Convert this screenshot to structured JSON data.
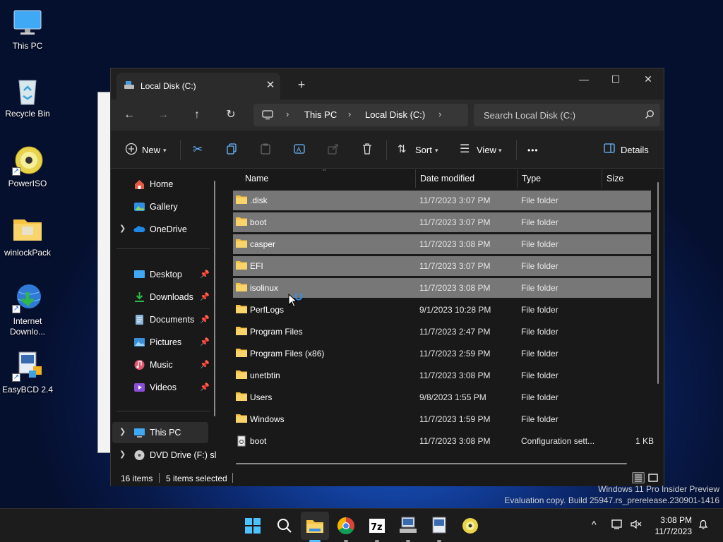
{
  "desktop": {
    "icons": [
      {
        "label": "This PC",
        "icon": "monitor-icon"
      },
      {
        "label": "Recycle Bin",
        "icon": "recycle-bin-icon"
      },
      {
        "label": "PowerISO",
        "icon": "disc-icon"
      },
      {
        "label": "winlockPack",
        "icon": "folder-icon"
      },
      {
        "label": "Internet Downlo...",
        "icon": "globe-download-icon"
      },
      {
        "label": "EasyBCD 2.4",
        "icon": "easybcd-icon"
      }
    ]
  },
  "window": {
    "tab_title": "Local Disk (C:)",
    "new_tab": "+",
    "controls": {
      "minimize": "—",
      "maximize": "☐",
      "close": "✕"
    }
  },
  "address": {
    "crumbs": [
      "This PC",
      "Local Disk (C:)"
    ],
    "search_placeholder": "Search Local Disk (C:)"
  },
  "commands": {
    "new": "New",
    "sort": "Sort",
    "view": "View",
    "more": "•••",
    "details": "Details"
  },
  "nav": {
    "home": "Home",
    "gallery": "Gallery",
    "onedrive": "OneDrive",
    "desktop": "Desktop",
    "downloads": "Downloads",
    "documents": "Documents",
    "pictures": "Pictures",
    "music": "Music",
    "videos": "Videos",
    "thispc": "This PC",
    "dvd": "DVD Drive (F:) sl"
  },
  "columns": {
    "name": "Name",
    "date": "Date modified",
    "type": "Type",
    "size": "Size"
  },
  "files": [
    {
      "name": ".disk",
      "date": "11/7/2023 3:07 PM",
      "type": "File folder",
      "size": "",
      "selected": true
    },
    {
      "name": "boot",
      "date": "11/7/2023 3:07 PM",
      "type": "File folder",
      "size": "",
      "selected": true
    },
    {
      "name": "casper",
      "date": "11/7/2023 3:08 PM",
      "type": "File folder",
      "size": "",
      "selected": true
    },
    {
      "name": "EFI",
      "date": "11/7/2023 3:07 PM",
      "type": "File folder",
      "size": "",
      "selected": true
    },
    {
      "name": "isolinux",
      "date": "11/7/2023 3:08 PM",
      "type": "File folder",
      "size": "",
      "selected": true
    },
    {
      "name": "PerfLogs",
      "date": "9/1/2023 10:28 PM",
      "type": "File folder",
      "size": "",
      "selected": false
    },
    {
      "name": "Program Files",
      "date": "11/7/2023 2:47 PM",
      "type": "File folder",
      "size": "",
      "selected": false
    },
    {
      "name": "Program Files (x86)",
      "date": "11/7/2023 2:59 PM",
      "type": "File folder",
      "size": "",
      "selected": false
    },
    {
      "name": "unetbtin",
      "date": "11/7/2023 3:08 PM",
      "type": "File folder",
      "size": "",
      "selected": false
    },
    {
      "name": "Users",
      "date": "9/8/2023 1:55 PM",
      "type": "File folder",
      "size": "",
      "selected": false
    },
    {
      "name": "Windows",
      "date": "11/7/2023 1:59 PM",
      "type": "File folder",
      "size": "",
      "selected": false
    },
    {
      "name": "boot",
      "date": "11/7/2023 3:08 PM",
      "type": "Configuration sett...",
      "size": "1 KB",
      "selected": false
    }
  ],
  "status": {
    "count": "16 items",
    "selected": "5 items selected"
  },
  "watermark": {
    "line1": "Windows 11 Pro Insider Preview",
    "line2": "Evaluation copy. Build 25947.rs_prerelease.230901-1416"
  },
  "taskbar": {
    "time": "3:08 PM",
    "date": "11/7/2023"
  },
  "colors": {
    "accent": "#4cc2ff",
    "folder": "#f5c242",
    "selected_row": "#777777"
  }
}
